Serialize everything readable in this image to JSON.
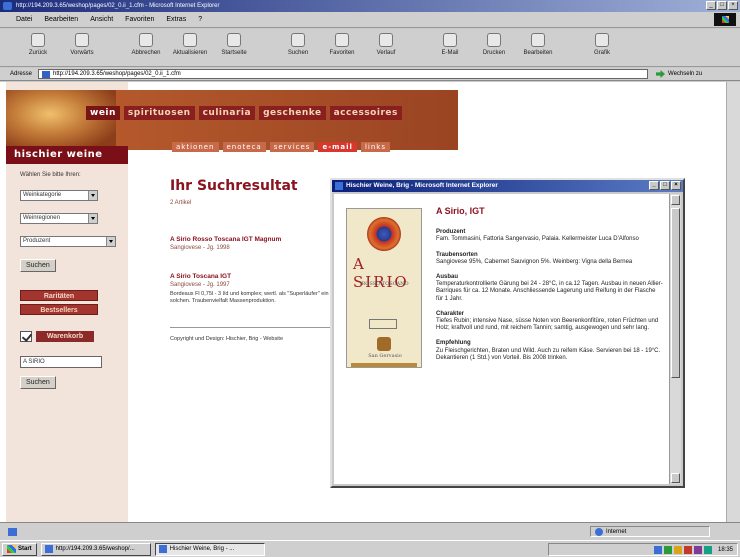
{
  "window": {
    "title": "http://194.209.3.65/weshop/pages/02_0.ii_1.cfm - Microsoft Internet Explorer"
  },
  "menu": [
    "Datei",
    "Bearbeiten",
    "Ansicht",
    "Favoriten",
    "Extras",
    "?"
  ],
  "toolbar": [
    "Zurück",
    "Vorwärts",
    "Abbrechen",
    "Aktualisieren",
    "Startseite",
    "Suchen",
    "Favoriten",
    "Verlauf",
    "E-Mail",
    "Drucken",
    "Bearbeiten",
    "Grafik"
  ],
  "address": {
    "label": "Adresse",
    "url": "http://194.209.3.65/weshop/pages/02_0.ii_1.cfm",
    "go": "Wechseln zu"
  },
  "site": {
    "nav_top": [
      "wein",
      "spirituosen",
      "culinaria",
      "geschenke",
      "accessoires"
    ],
    "nav_sub": [
      "aktionen",
      "enoteca",
      "services",
      "e-mail",
      "links"
    ],
    "brand": "hischier weine",
    "sidebar": {
      "heading": "Wählen Sie bitte Ihren:",
      "selects": [
        "Weinkategorie",
        "Weinregionen",
        "Produzent"
      ],
      "search_button": "Suchen",
      "raritaeten": "Raritäten",
      "bestseller": "Bestsellers",
      "cart": "Warenkorb",
      "search_value": "A SIRIO",
      "search_button2": "Suchen"
    },
    "main": {
      "title": "Ihr Suchresultat",
      "count": "2 Artikel",
      "results": [
        {
          "title": "A Sirio Rosso Toscana IGT Magnum",
          "sub": "Sangiovese - Jg. 1998",
          "desc": ""
        },
        {
          "title": "A Sirio Toscana IGT",
          "sub": "Sangiovese - Jg. 1997",
          "desc": "Bordeaux Fl 0,75l - 3 l/d und komplex; wertl. als \"Superläufer\" ein s. Stil solchen. Traubenvielfalt Massenproduktion."
        }
      ],
      "footer": "Copyright und Design: Hischier, Brig  -  Website"
    }
  },
  "popup": {
    "title": "Hischier Weine, Brig - Microsoft Internet Explorer",
    "wine_name": "A Sirio, IGT",
    "label_text": {
      "name": "A SIRIO",
      "sub": "ROSSO TOSCANO",
      "producer": "San Gervasio"
    },
    "sections": [
      {
        "heading": "Produzent",
        "text": "Fam. Tommasini, Fattoria Sangervasio, Palaia. Kellermeister Luca D'Alfonso"
      },
      {
        "heading": "Traubensorten",
        "text": "Sangiovese 95%, Cabernet Sauvignon 5%. Weinberg: Vigna della Bernea"
      },
      {
        "heading": "Ausbau",
        "text": "Temperaturkontrollierte Gärung bei 24 - 28°C, in ca.12 Tagen. Ausbau in neuen Allier-Barriques für ca. 12 Monate. Anschliessende Lagerung und Reifung in der Flasche für 1 Jahr."
      },
      {
        "heading": "Charakter",
        "text": "Tiefes Rubin; intensive Nase, süsse Noten von Beerenkonfitüre, roten Früchten und Holz; kraftvoll und rund, mit reichem Tannin; samtig, ausgewogen und sehr lang."
      },
      {
        "heading": "Empfehlung",
        "text": "Zu Fleischgerichten, Braten und Wild. Auch zu reifem Käse. Servieren bei 18 - 19°C. Dekantieren (1 Std.) von Vorteil. Bis 2008 trinken."
      }
    ]
  },
  "status": {
    "zone": "Internet"
  },
  "taskbar": {
    "start": "Start",
    "tasks": [
      "http://194.209.3.65/weshop/...",
      "Hischier Weine, Brig - ..."
    ],
    "clock": "18:35"
  }
}
